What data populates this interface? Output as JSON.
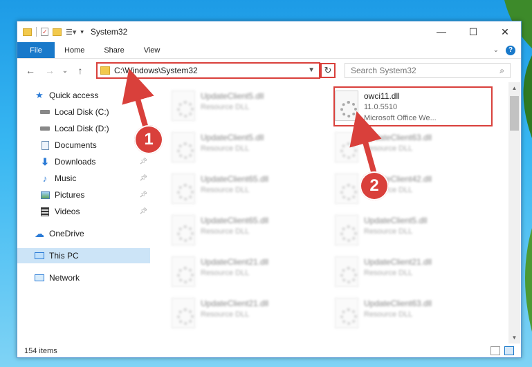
{
  "window": {
    "title": "System32"
  },
  "ribbon": {
    "tabs": [
      "File",
      "Home",
      "Share",
      "View"
    ],
    "help": "?"
  },
  "window_controls": {
    "minimize": "—",
    "maximize": "☐",
    "close": "✕"
  },
  "navbar": {
    "back": "←",
    "forward": "→",
    "recent": "⌄",
    "up": "↑",
    "address": "C:\\Windows\\System32",
    "refresh": "↻",
    "search_placeholder": "Search System32"
  },
  "sidebar": {
    "items": [
      {
        "label": "Quick access",
        "icon": "star-icon",
        "pinned": false
      },
      {
        "label": "Local Disk (C:)",
        "icon": "drive-icon",
        "pinned": false
      },
      {
        "label": "Local Disk (D:)",
        "icon": "drive-icon",
        "pinned": false
      },
      {
        "label": "Documents",
        "icon": "documents-icon",
        "pinned": false
      },
      {
        "label": "Downloads",
        "icon": "download-icon",
        "pinned": true
      },
      {
        "label": "Music",
        "icon": "music-icon",
        "pinned": true
      },
      {
        "label": "Pictures",
        "icon": "pictures-icon",
        "pinned": true
      },
      {
        "label": "Videos",
        "icon": "videos-icon",
        "pinned": true
      },
      {
        "label": "OneDrive",
        "icon": "cloud-icon",
        "pinned": false
      },
      {
        "label": "This PC",
        "icon": "computer-icon",
        "pinned": false,
        "selected": true
      },
      {
        "label": "Network",
        "icon": "network-icon",
        "pinned": false
      }
    ]
  },
  "files": {
    "highlighted": {
      "name": "owci11.dll",
      "version": "11.0.5510",
      "description": "Microsoft Office We..."
    },
    "left_column": [
      {
        "name": "UpdateClient5.dll",
        "type": "Resource DLL"
      },
      {
        "name": "UpdateClient5.dll",
        "type": "Resource DLL"
      },
      {
        "name": "UpdateClient65.dll",
        "type": "Resource DLL"
      },
      {
        "name": "UpdateClient65.dll",
        "type": "Resource DLL"
      },
      {
        "name": "UpdateClient21.dll",
        "type": "Resource DLL"
      },
      {
        "name": "UpdateClient21.dll",
        "type": "Resource DLL"
      }
    ],
    "right_column": [
      {
        "name": "UpdateClient63.dll",
        "type": "Resource DLL"
      },
      {
        "name": "UpdateClient42.dll",
        "type": "Resource DLL"
      },
      {
        "name": "UpdateClient5.dll",
        "type": "Resource DLL"
      },
      {
        "name": "UpdateClient21.dll",
        "type": "Resource DLL"
      },
      {
        "name": "UpdateClient63.dll",
        "type": "Resource DLL"
      }
    ]
  },
  "status": {
    "items": "154 items"
  },
  "callouts": [
    "1",
    "2"
  ],
  "colors": {
    "accent": "#1979ca",
    "highlight": "#d9403b",
    "selected": "#cce4f7"
  }
}
